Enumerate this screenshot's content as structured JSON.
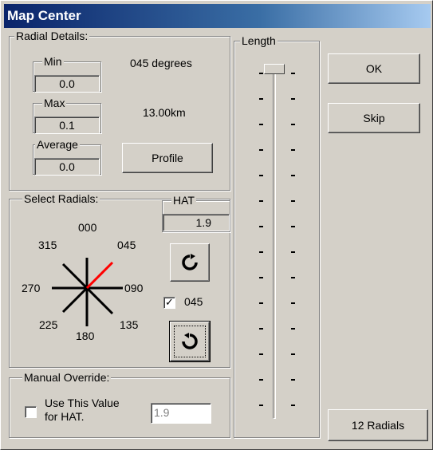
{
  "window": {
    "title": "Map Center"
  },
  "radial_details": {
    "label": "Radial Details:",
    "min": {
      "label": "Min",
      "value": "0.0"
    },
    "max": {
      "label": "Max",
      "value": "0.1"
    },
    "average": {
      "label": "Average",
      "value": "0.0"
    },
    "bearing": "045 degrees",
    "distance": "13.00km",
    "profile_button": "Profile"
  },
  "length": {
    "label": "Length"
  },
  "buttons": {
    "ok": "OK",
    "skip": "Skip",
    "radials": "12 Radials"
  },
  "select_radials": {
    "label": "Select Radials:",
    "hat_label": "HAT",
    "hat_value": "1.9",
    "compass": {
      "n": "000",
      "ne": "045",
      "e": "090",
      "se": "135",
      "s": "180",
      "sw": "225",
      "w": "270",
      "nw": "315"
    },
    "highlight_color": "#ff0000",
    "checkbox_label": "045",
    "checkbox_checked": true
  },
  "manual_override": {
    "label": "Manual Override:",
    "checkbox_label_1": "Use This Value",
    "checkbox_label_2": "for HAT.",
    "checkbox_checked": false,
    "value": "1.9"
  }
}
